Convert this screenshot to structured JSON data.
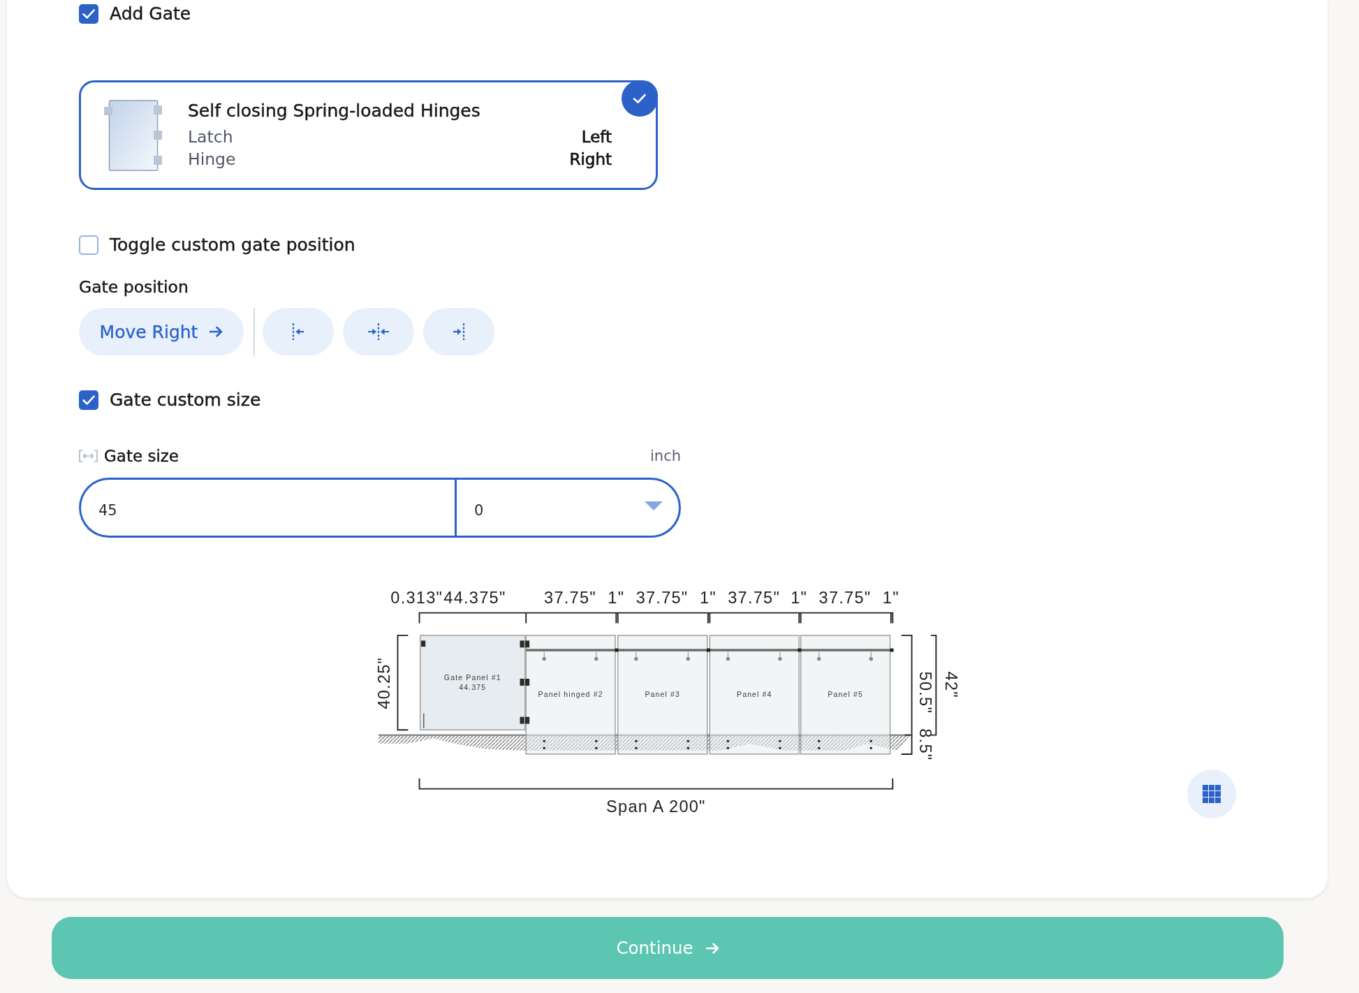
{
  "add_gate": {
    "label": "Add Gate",
    "checked": true
  },
  "gate_option": {
    "title": "Self closing Spring-loaded Hinges",
    "selected": true,
    "specs": [
      {
        "label": "Latch",
        "value": "Left"
      },
      {
        "label": "Hinge",
        "value": "Right"
      }
    ]
  },
  "custom_position": {
    "label": "Toggle custom gate position",
    "checked": false
  },
  "gate_position": {
    "label": "Gate position",
    "buttons": [
      {
        "kind": "move",
        "label": "Move Right"
      },
      {
        "kind": "start"
      },
      {
        "kind": "center"
      },
      {
        "kind": "end"
      }
    ]
  },
  "custom_size": {
    "label": "Gate custom size",
    "checked": true
  },
  "gate_size": {
    "label": "Gate size",
    "unit": "inch",
    "value": "45",
    "fraction": "0"
  },
  "diagram": {
    "top_dimensions": [
      "0.313\"",
      "44.375\"",
      "37.75\"",
      "1\"",
      "37.75\"",
      "1\"",
      "37.75\"",
      "1\"",
      "37.75\"",
      "1\""
    ],
    "panels": [
      {
        "kind": "gate",
        "label": "Gate Panel #1",
        "size_label": "44.375"
      },
      {
        "kind": "hinged",
        "label": "Panel hinged #2"
      },
      {
        "kind": "fixed",
        "label": "Panel #3"
      },
      {
        "kind": "fixed",
        "label": "Panel #4"
      },
      {
        "kind": "fixed",
        "label": "Panel #5"
      }
    ],
    "gate_height": "40.25\"",
    "panel_height": "50.5\"",
    "embed_depth": "8.5\"",
    "rail_height": "42\"",
    "span_label": "Span A 200\""
  },
  "continue_button": {
    "label": "Continue"
  }
}
